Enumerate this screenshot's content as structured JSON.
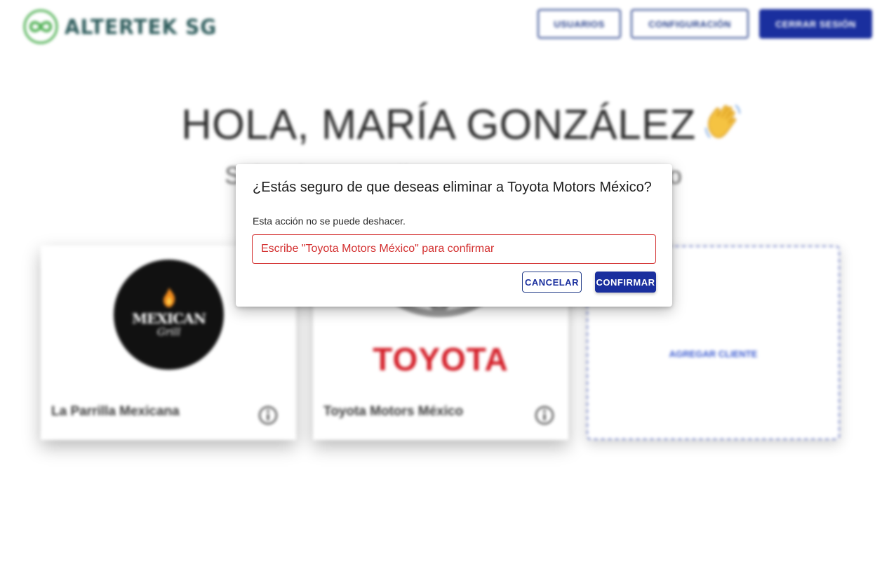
{
  "header": {
    "logo_text": "ALTERTEK SG",
    "nav": {
      "users_label": "USUARIOS",
      "config_label": "CONFIGURACIÓN",
      "logout_label": "CERRAR SESIÓN"
    }
  },
  "main": {
    "greeting": "HOLA, MARÍA GONZÁLEZ",
    "greeting_emoji": "waving-hand-icon",
    "subtitle": "Selecciona un cliente o agrega uno nuevo",
    "clients": [
      {
        "name": "La Parrilla Mexicana",
        "logo": "mexican-grill-logo",
        "logo_line1": "MEXICAN",
        "logo_line2": "Grill"
      },
      {
        "name": "Toyota Motors México",
        "logo": "toyota-logo",
        "logo_word": "TOYOTA"
      }
    ],
    "add_client_label": "AGREGAR CLIENTE"
  },
  "modal": {
    "title": "¿Estás seguro de que deseas eliminar a Toyota Motors México?",
    "description": "Esta acción no se puede deshacer.",
    "input_placeholder": "Escribe \"Toyota Motors México\" para confirmar",
    "input_value": "",
    "cancel_label": "CANCELAR",
    "confirm_label": "CONFIRMAR"
  },
  "colors": {
    "primary": "#1a2f9e",
    "error": "#d32f2f",
    "logo_green": "#4caf50",
    "toyota_red": "#d4202a"
  }
}
